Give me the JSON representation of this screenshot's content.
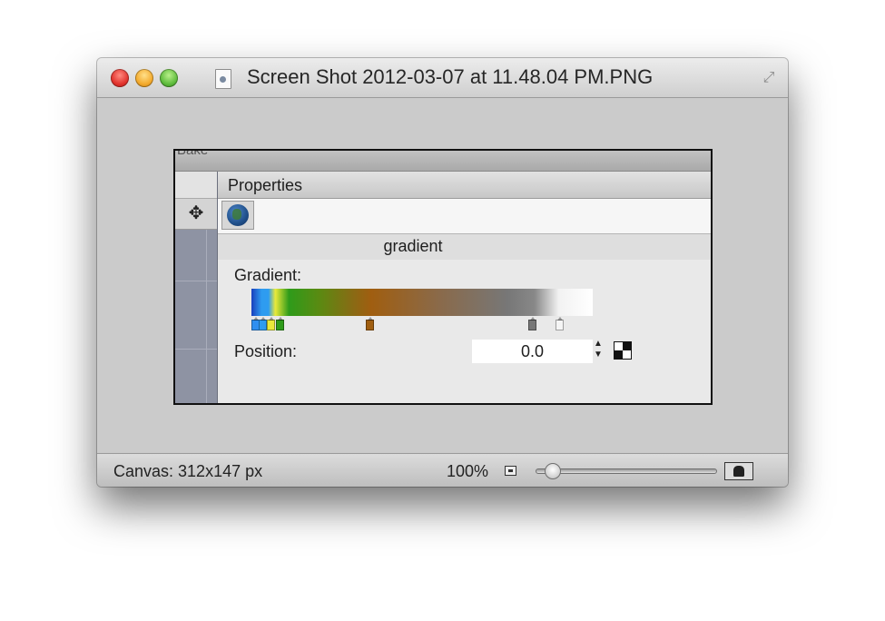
{
  "window": {
    "title": "Screen Shot 2012-03-07 at 11.48.04 PM.PNG",
    "buttons": {
      "close": "close-icon",
      "minimize": "minimize-icon",
      "zoom": "zoom-icon"
    },
    "doc_icon": "document-icon",
    "resize_icon": "fullscreen-icon"
  },
  "canvas": {
    "top_strip_text": "Bake",
    "panel": {
      "title": "Properties",
      "move_tool_icon": "move-arrows-icon",
      "object_icon": "globe-icon",
      "section_title": "gradient",
      "gradient_label": "Gradient:",
      "gradient_stops": [
        {
          "color": "#2e8ff0"
        },
        {
          "color": "#2e9cf0"
        },
        {
          "color": "#e9e93a"
        },
        {
          "color": "#2e9b1a"
        },
        {
          "color": "#a05e10"
        },
        {
          "color": "#777777"
        },
        {
          "color": "#f5f5f5"
        }
      ],
      "position_label": "Position:",
      "position_value": "0.0"
    }
  },
  "statusbar": {
    "canvas_info": "Canvas: 312x147 px",
    "zoom": "100%",
    "zoom_slider_level": 0.07
  }
}
